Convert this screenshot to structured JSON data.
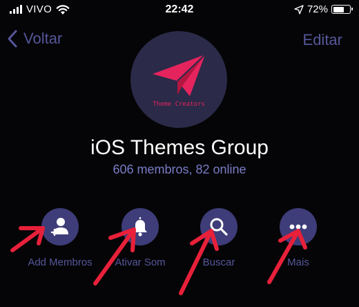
{
  "status_bar": {
    "carrier": "VIVO",
    "time": "22:42",
    "battery_percent": "72%",
    "battery_level": 0.72,
    "icons": [
      "signal-bars-icon",
      "wifi-icon",
      "location-arrow-icon",
      "battery-icon"
    ]
  },
  "nav": {
    "back_label": "Voltar",
    "edit_label": "Editar"
  },
  "group": {
    "avatar_caption": "Theme Creators",
    "title": "iOS Themes Group",
    "subtitle": "606 membros, 82 online"
  },
  "actions": [
    {
      "label": "Add Membros",
      "icon": "add-member-icon"
    },
    {
      "label": "Ativar Som",
      "icon": "bell-icon"
    },
    {
      "label": "Buscar",
      "icon": "search-icon"
    },
    {
      "label": "Mais",
      "icon": "more-dots-icon"
    }
  ],
  "colors": {
    "background": "#050507",
    "accent": "#56579a",
    "button_fill": "#3e3d79",
    "avatar_bg": "#2b2a48",
    "logo_pink": "#e5245e",
    "annotation_red": "#e8203a"
  }
}
